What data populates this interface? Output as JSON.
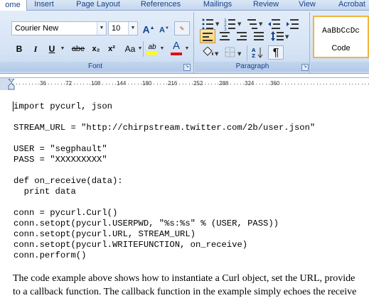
{
  "tabs": [
    {
      "label": "ome",
      "active": true
    },
    {
      "label": "Insert",
      "active": false
    },
    {
      "label": "Page Layout",
      "active": false
    },
    {
      "label": "References",
      "active": false
    },
    {
      "label": "Mailings",
      "active": false
    },
    {
      "label": "Review",
      "active": false
    },
    {
      "label": "View",
      "active": false
    },
    {
      "label": "Acrobat",
      "active": false
    }
  ],
  "font_group": {
    "font_name": "Courier New",
    "font_size": "10",
    "label": "Font",
    "grow_icon": "A",
    "shrink_icon": "A",
    "bold": "B",
    "italic": "I",
    "underline": "U",
    "strikethrough": "abe",
    "subscript": "x₂",
    "superscript": "x²",
    "change_case": "Aa",
    "highlight": "ab",
    "font_color": "A"
  },
  "paragraph_group": {
    "label": "Paragraph",
    "show_marks": "¶"
  },
  "styles_group": {
    "preview": "AaBbCcDc",
    "style_name": "Code"
  },
  "ruler": {
    "marks": [
      "36",
      "72",
      "108",
      "144",
      "180",
      "216",
      "252",
      "288",
      "324",
      "360"
    ]
  },
  "document": {
    "code_lines": [
      "import pycurl, json",
      "",
      "STREAM_URL = \"http://chirpstream.twitter.com/2b/user.json\"",
      "",
      "USER = \"segphault\"",
      "PASS = \"XXXXXXXXX\"",
      "",
      "def on_receive(data):",
      "  print data",
      "",
      "conn = pycurl.Curl()",
      "conn.setopt(pycurl.USERPWD, \"%s:%s\" % (USER, PASS))",
      "conn.setopt(pycurl.URL, STREAM_URL)",
      "conn.setopt(pycurl.WRITEFUNCTION, on_receive)",
      "conn.perform()"
    ],
    "paragraph_line1": "The code example above shows how to instantiate a Curl object, set the URL, provide",
    "paragraph_line2": "to a callback function. The callback function in the example simply echoes the receive"
  },
  "colors": {
    "ribbon_bg": "#d6e4f5",
    "tab_text": "#15428b",
    "selected_style_border": "#f2b33d",
    "selected_align": "#fbd27a",
    "font_color_bar": "#e01010",
    "highlight_bar": "#ffff00"
  }
}
